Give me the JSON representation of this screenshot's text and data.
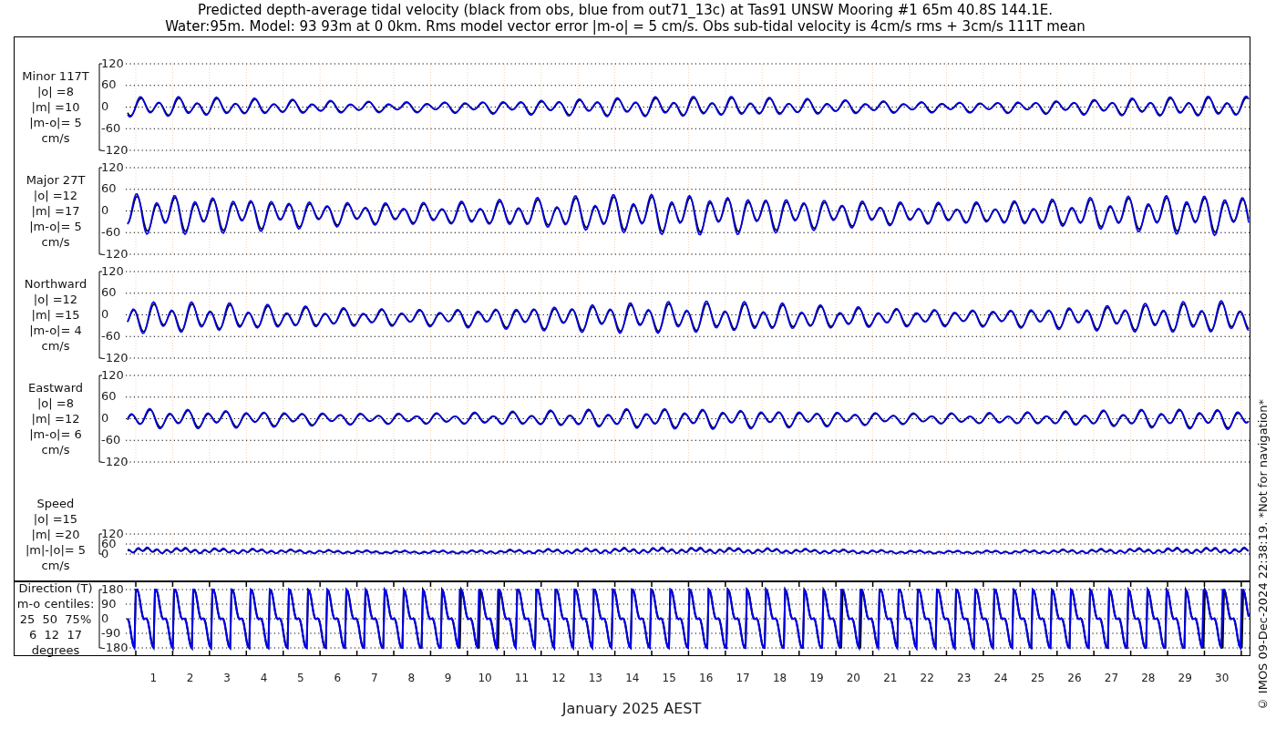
{
  "title": "Predicted depth-average tidal velocity (black from obs, blue from out71_13c) at Tas91 UNSW Mooring #1 65m 40.8S 144.1E.",
  "subtitle": "Water:95m. Model: 93 93m at 0 0km. Rms model vector error |m-o| = 5 cm/s. Obs sub-tidal velocity is 4cm/s rms + 3cm/s 111T mean",
  "panels": [
    {
      "kind": "velocity",
      "label": [
        "Minor 117T",
        "|o| =8",
        "|m| =10",
        "|m-o|= 5",
        "cm/s"
      ],
      "yticks": [
        "120",
        "60",
        "0",
        "-60",
        "-120"
      ]
    },
    {
      "kind": "velocity",
      "label": [
        "Major 27T",
        "|o| =12",
        "|m| =17",
        "|m-o|= 5",
        "cm/s"
      ],
      "yticks": [
        "120",
        "60",
        "0",
        "-60",
        "-120"
      ]
    },
    {
      "kind": "velocity",
      "label": [
        "Northward",
        "|o| =12",
        "|m| =15",
        "|m-o|= 4",
        "cm/s"
      ],
      "yticks": [
        "120",
        "60",
        "0",
        "-60",
        "-120"
      ]
    },
    {
      "kind": "velocity",
      "label": [
        "Eastward",
        "|o| =8",
        "|m| =12",
        "|m-o|= 6",
        "cm/s"
      ],
      "yticks": [
        "120",
        "60",
        "0",
        "-60",
        "-120"
      ]
    },
    {
      "kind": "speed",
      "label": [
        "Speed",
        "|o| =15",
        "|m| =20",
        "|m|-|o|= 5",
        "cm/s"
      ],
      "yticks": [
        "120",
        "60",
        "0"
      ]
    },
    {
      "kind": "direction",
      "label": [
        "Direction (T)",
        "m-o centiles:",
        "25  50  75%",
        "6  12  17",
        "degrees"
      ],
      "yticks": [
        "180",
        "90",
        "0",
        "-90",
        "-180"
      ]
    }
  ],
  "xticks": [
    "1",
    "2",
    "3",
    "4",
    "5",
    "6",
    "7",
    "8",
    "9",
    "10",
    "11",
    "12",
    "13",
    "14",
    "15",
    "16",
    "17",
    "18",
    "19",
    "20",
    "21",
    "22",
    "23",
    "24",
    "25",
    "26",
    "27",
    "28",
    "29",
    "30"
  ],
  "xlabel": "January 2025 AEST",
  "credit": "© IMOS 09-Dec-2024 22:38:19. *Not for navigation*"
}
